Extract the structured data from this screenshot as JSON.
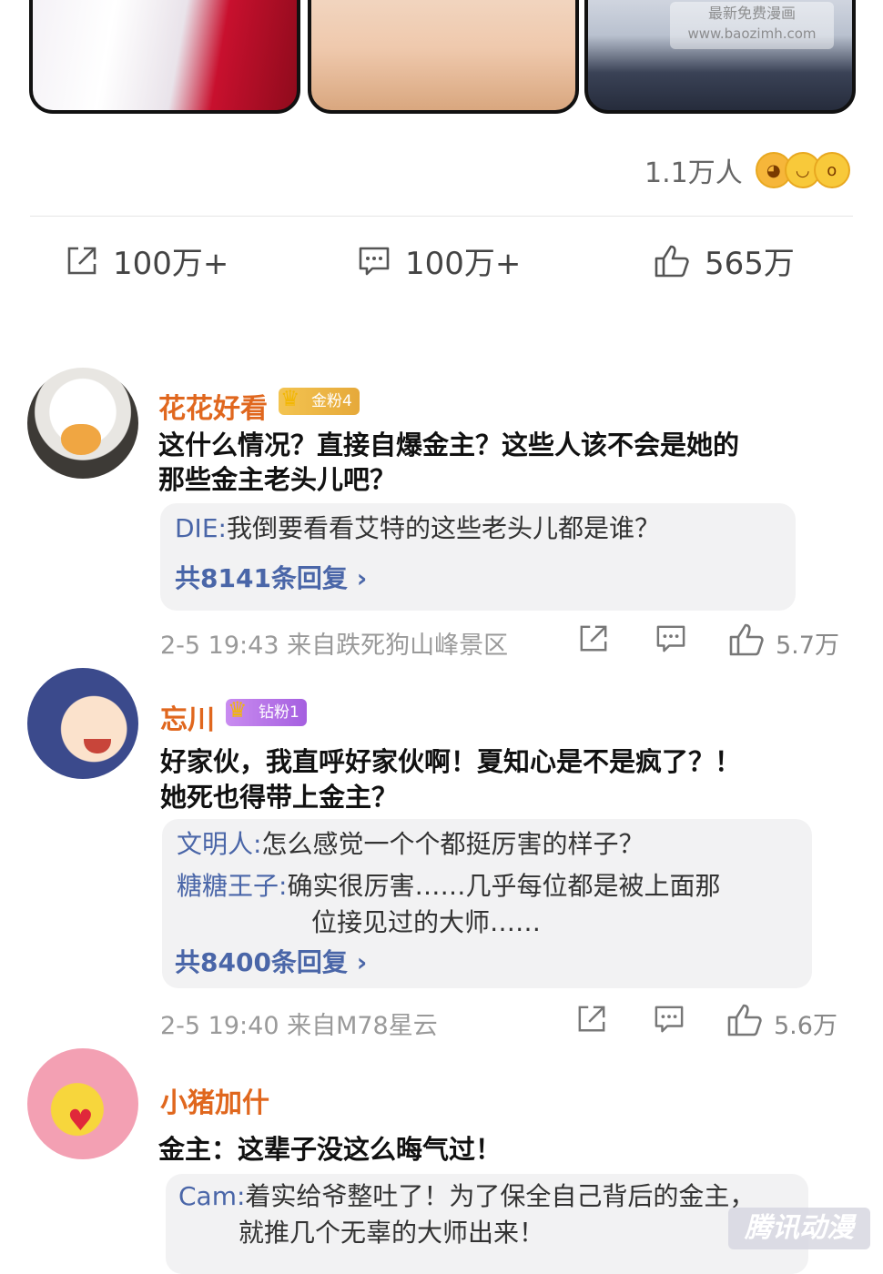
{
  "comic": {
    "watermark_line1": "最新免费漫画",
    "watermark_line2": "www.baozimh.com"
  },
  "post": {
    "reaction_count": "1.1万人",
    "reaction_emojis": [
      "smirk-emoji",
      "grin-emoji",
      "surprised-emoji"
    ],
    "share_count": "100万+",
    "comment_count": "100万+",
    "like_count": "565万"
  },
  "comments": [
    {
      "user": "花花好看",
      "badge": "金粉4",
      "text_line1": "这什么情况？直接自爆金主？这些人该不会是她的",
      "text_line2": "那些金主老头儿吧？",
      "replies": [
        {
          "name": "DIE:",
          "text": "我倒要看看艾特的这些老头儿都是谁？"
        }
      ],
      "reply_total": "共8141条回复 ",
      "time_location": "2-5 19:43  来自跌死狗山峰景区",
      "likes": "5.7万"
    },
    {
      "user": "忘川",
      "badge": "钻粉1",
      "text_line1": "好家伙，我直呼好家伙啊！夏知心是不是疯了？！",
      "text_line2": "她死也得带上金主？",
      "replies": [
        {
          "name": "文明人:",
          "text": "怎么感觉一个个都挺厉害的样子？"
        },
        {
          "name": "糖糖王子:",
          "text": "确实很厉害……几乎每位都是被上面那",
          "text2": "位接见过的大师……"
        }
      ],
      "reply_total": "共8400条回复 ",
      "time_location": "2-5 19:40  来自M78星云",
      "likes": "5.6万"
    },
    {
      "user": "小猪加什",
      "text_line1": "金主：这辈子没这么晦气过！",
      "replies": [
        {
          "name": "Cam:",
          "text": "着实给爷整吐了！为了保全自己背后的金主，",
          "text2": "就推几个无辜的大师出来！"
        }
      ]
    }
  ],
  "brand_watermark": "腾讯动漫"
}
